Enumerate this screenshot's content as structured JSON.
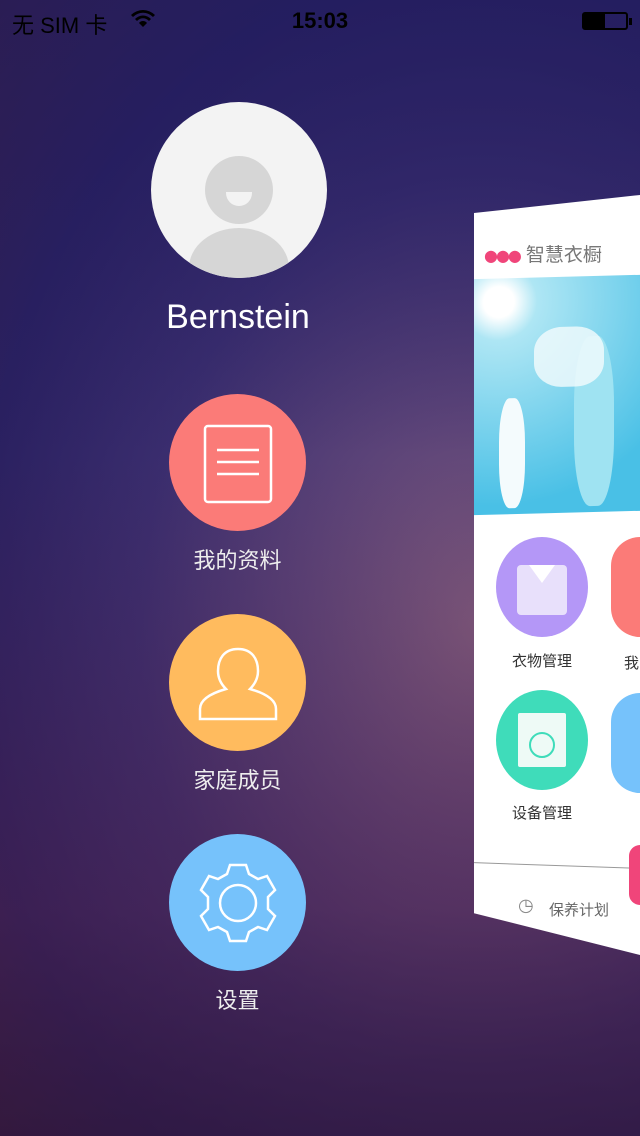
{
  "status_bar": {
    "carrier": "无 SIM 卡",
    "time": "15:03",
    "battery_percent": 50
  },
  "profile": {
    "name": "Bernstein"
  },
  "menu": [
    {
      "label": "我的资料",
      "icon": "notepad-icon",
      "color": "#fb7b78"
    },
    {
      "label": "家庭成员",
      "icon": "person-icon",
      "color": "#ffbb5e"
    },
    {
      "label": "设置",
      "icon": "gear-icon",
      "color": "#76c2fb"
    }
  ],
  "card": {
    "title": "智慧衣橱",
    "grid": [
      {
        "label": "衣物管理",
        "icon": "shirt-icon",
        "color": "#b497f7"
      },
      {
        "label": "我",
        "icon": "notepad-icon",
        "color": "#fb7b78"
      },
      {
        "label": "设备管理",
        "icon": "washing-machine-icon",
        "color": "#3fdcba"
      },
      {
        "label": "",
        "icon": "chat-icon",
        "color": "#76c2fb"
      }
    ],
    "bottom_tab": "保养计划"
  }
}
